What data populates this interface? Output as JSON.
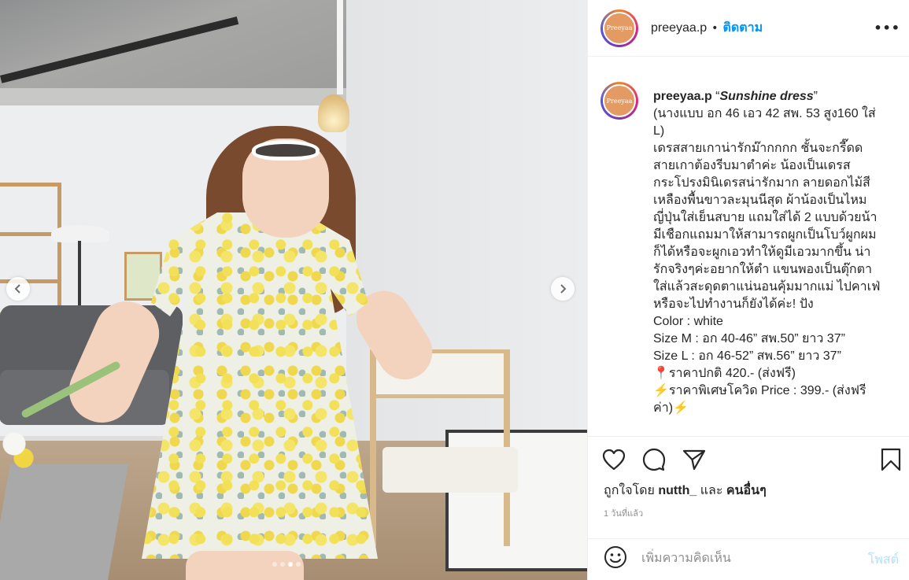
{
  "post": {
    "username": "preeyaa.p",
    "separator": "•",
    "follow_label": "ติดตาม",
    "more_label": "•••",
    "avatar_text": "Preeyaa",
    "caption": {
      "username": "preeyaa.p",
      "quote_open": "“",
      "title": "Sunshine dress",
      "quote_close": "”",
      "lines": [
        "(นางแบบ อก 46 เอว 42 สพ. 53 สูง160 ใส่",
        "L)",
        "เดรสสายเกาน่ารักม๊ากกกก ชั้นจะกรี๊ดด",
        "สายเกาต้องรีบมาตำค่ะ น้องเป็นเดรส",
        "กระโปรงมินิเดรสน่ารักมาก ลายดอกไม้สี",
        "เหลืองพื้นขาวละมุนนีสุด ผ้าน้องเป็นไหม",
        "ญี่ปุ่นใส่เย็นสบาย แถมใส่ได้ 2 แบบด้วยน้า",
        "มีเชือกแถมมาให้สามารถผูกเป็นโบว์ผูกผม",
        "ก็ได้หรือจะผูกเอวทำให้ดูมีเอวมากขึ้น น่า",
        "รักจริงๆค่ะอยากให้ตำ แขนพองเป็นตุ๊กตา",
        "ใส่แล้วสะดุดตาแน่นอนคุ้มมากแม่ ไปคาเฟ่",
        "หรือจะไปทำงานก็ยังได้ค่ะ! ปัง",
        "Color : white",
        "Size M : อก 40-46” สพ.50” ยาว 37”",
        "Size L : อก 46-52” สพ.56” ยาว 37”",
        "📍ราคาปกติ 420.- (ส่งฟรี)",
        "⚡ราคาพิเศษโควิด Price : 399.- (ส่งฟรี",
        "ค่า)⚡"
      ]
    },
    "likes": {
      "prefix": "ถูกใจโดย",
      "user": "nutth_",
      "and": "และ",
      "others": "คนอื่นๆ"
    },
    "time_ago": "1 วันที่แล้ว",
    "comment": {
      "placeholder": "เพิ่มความคิดเห็น",
      "post_label": "โพสต์"
    }
  },
  "carousel": {
    "prev_icon": "chevron-left-icon",
    "next_icon": "chevron-right-icon",
    "slide_count": 4,
    "active_index": 2
  },
  "icons": {
    "like": "heart-icon",
    "comment": "comment-icon",
    "share": "send-icon",
    "save": "bookmark-icon",
    "emoji": "emoji-icon"
  },
  "colors": {
    "link_blue": "#0095f6",
    "post_disabled": "#b2dffc",
    "muted": "#8e8e8e",
    "text": "#262626",
    "divider": "#efefef"
  }
}
